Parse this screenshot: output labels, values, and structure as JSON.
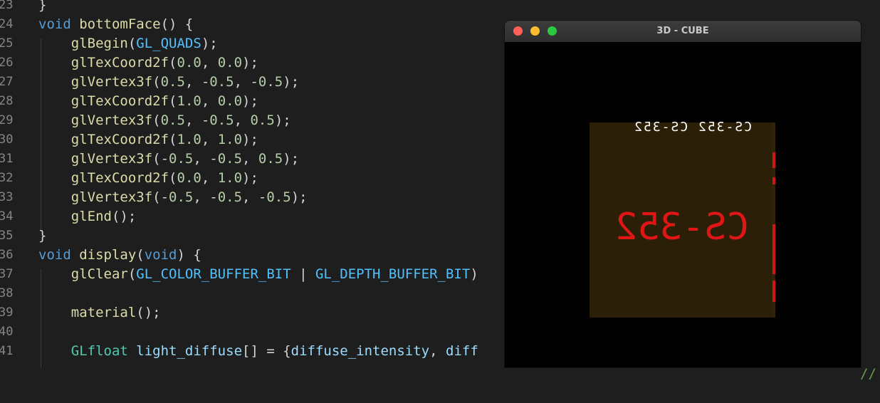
{
  "editor": {
    "lines": [
      {
        "num": "23",
        "tokens": [
          {
            "t": "}",
            "c": "pl"
          }
        ]
      },
      {
        "num": "24",
        "tokens": [
          {
            "t": "void ",
            "c": "kw"
          },
          {
            "t": "bottomFace",
            "c": "fn"
          },
          {
            "t": "() {",
            "c": "pl"
          }
        ]
      },
      {
        "num": "25",
        "tokens": [
          {
            "t": "    ",
            "c": "pl"
          },
          {
            "t": "glBegin",
            "c": "fn"
          },
          {
            "t": "(",
            "c": "pl"
          },
          {
            "t": "GL_QUADS",
            "c": "const"
          },
          {
            "t": ");",
            "c": "pl"
          }
        ]
      },
      {
        "num": "26",
        "tokens": [
          {
            "t": "    ",
            "c": "pl"
          },
          {
            "t": "glTexCoord2f",
            "c": "fn"
          },
          {
            "t": "(",
            "c": "pl"
          },
          {
            "t": "0.0",
            "c": "num"
          },
          {
            "t": ", ",
            "c": "pl"
          },
          {
            "t": "0.0",
            "c": "num"
          },
          {
            "t": ");",
            "c": "pl"
          }
        ]
      },
      {
        "num": "27",
        "tokens": [
          {
            "t": "    ",
            "c": "pl"
          },
          {
            "t": "glVertex3f",
            "c": "fn"
          },
          {
            "t": "(",
            "c": "pl"
          },
          {
            "t": "0.5",
            "c": "num"
          },
          {
            "t": ", -",
            "c": "pl"
          },
          {
            "t": "0.5",
            "c": "num"
          },
          {
            "t": ", -",
            "c": "pl"
          },
          {
            "t": "0.5",
            "c": "num"
          },
          {
            "t": ");",
            "c": "pl"
          }
        ]
      },
      {
        "num": "28",
        "tokens": [
          {
            "t": "    ",
            "c": "pl"
          },
          {
            "t": "glTexCoord2f",
            "c": "fn"
          },
          {
            "t": "(",
            "c": "pl"
          },
          {
            "t": "1.0",
            "c": "num"
          },
          {
            "t": ", ",
            "c": "pl"
          },
          {
            "t": "0.0",
            "c": "num"
          },
          {
            "t": ");",
            "c": "pl"
          }
        ]
      },
      {
        "num": "29",
        "tokens": [
          {
            "t": "    ",
            "c": "pl"
          },
          {
            "t": "glVertex3f",
            "c": "fn"
          },
          {
            "t": "(",
            "c": "pl"
          },
          {
            "t": "0.5",
            "c": "num"
          },
          {
            "t": ", -",
            "c": "pl"
          },
          {
            "t": "0.5",
            "c": "num"
          },
          {
            "t": ", ",
            "c": "pl"
          },
          {
            "t": "0.5",
            "c": "num"
          },
          {
            "t": ");",
            "c": "pl"
          }
        ]
      },
      {
        "num": "30",
        "tokens": [
          {
            "t": "    ",
            "c": "pl"
          },
          {
            "t": "glTexCoord2f",
            "c": "fn"
          },
          {
            "t": "(",
            "c": "pl"
          },
          {
            "t": "1.0",
            "c": "num"
          },
          {
            "t": ", ",
            "c": "pl"
          },
          {
            "t": "1.0",
            "c": "num"
          },
          {
            "t": ");",
            "c": "pl"
          }
        ]
      },
      {
        "num": "31",
        "tokens": [
          {
            "t": "    ",
            "c": "pl"
          },
          {
            "t": "glVertex3f",
            "c": "fn"
          },
          {
            "t": "(-",
            "c": "pl"
          },
          {
            "t": "0.5",
            "c": "num"
          },
          {
            "t": ", -",
            "c": "pl"
          },
          {
            "t": "0.5",
            "c": "num"
          },
          {
            "t": ", ",
            "c": "pl"
          },
          {
            "t": "0.5",
            "c": "num"
          },
          {
            "t": ");",
            "c": "pl"
          }
        ]
      },
      {
        "num": "32",
        "tokens": [
          {
            "t": "    ",
            "c": "pl"
          },
          {
            "t": "glTexCoord2f",
            "c": "fn"
          },
          {
            "t": "(",
            "c": "pl"
          },
          {
            "t": "0.0",
            "c": "num"
          },
          {
            "t": ", ",
            "c": "pl"
          },
          {
            "t": "1.0",
            "c": "num"
          },
          {
            "t": ");",
            "c": "pl"
          }
        ]
      },
      {
        "num": "33",
        "tokens": [
          {
            "t": "    ",
            "c": "pl"
          },
          {
            "t": "glVertex3f",
            "c": "fn"
          },
          {
            "t": "(-",
            "c": "pl"
          },
          {
            "t": "0.5",
            "c": "num"
          },
          {
            "t": ", -",
            "c": "pl"
          },
          {
            "t": "0.5",
            "c": "num"
          },
          {
            "t": ", -",
            "c": "pl"
          },
          {
            "t": "0.5",
            "c": "num"
          },
          {
            "t": ");",
            "c": "pl"
          }
        ]
      },
      {
        "num": "34",
        "tokens": [
          {
            "t": "    ",
            "c": "pl"
          },
          {
            "t": "glEnd",
            "c": "fn"
          },
          {
            "t": "();",
            "c": "pl"
          }
        ]
      },
      {
        "num": "35",
        "tokens": [
          {
            "t": "}",
            "c": "pl"
          }
        ]
      },
      {
        "num": "36",
        "tokens": [
          {
            "t": "void ",
            "c": "kw"
          },
          {
            "t": "display",
            "c": "fn"
          },
          {
            "t": "(",
            "c": "pl"
          },
          {
            "t": "void",
            "c": "kw"
          },
          {
            "t": ") {",
            "c": "pl"
          }
        ]
      },
      {
        "num": "37",
        "tokens": [
          {
            "t": "    ",
            "c": "pl"
          },
          {
            "t": "glClear",
            "c": "fn"
          },
          {
            "t": "(",
            "c": "pl"
          },
          {
            "t": "GL_COLOR_BUFFER_BIT",
            "c": "const"
          },
          {
            "t": " | ",
            "c": "pl"
          },
          {
            "t": "GL_DEPTH_BUFFER_BIT",
            "c": "const"
          },
          {
            "t": ")",
            "c": "pl"
          }
        ]
      },
      {
        "num": "38",
        "tokens": []
      },
      {
        "num": "39",
        "tokens": [
          {
            "t": "    ",
            "c": "pl"
          },
          {
            "t": "material",
            "c": "fn"
          },
          {
            "t": "();",
            "c": "pl"
          }
        ]
      },
      {
        "num": "40",
        "tokens": []
      },
      {
        "num": "41",
        "tokens": [
          {
            "t": "    ",
            "c": "pl"
          },
          {
            "t": "GLfloat",
            "c": "ty"
          },
          {
            "t": " ",
            "c": "pl"
          },
          {
            "t": "light_diffuse",
            "c": "var"
          },
          {
            "t": "[] = {",
            "c": "pl"
          },
          {
            "t": "diffuse_intensity",
            "c": "var"
          },
          {
            "t": ", ",
            "c": "pl"
          },
          {
            "t": "diff",
            "c": "var"
          }
        ]
      }
    ],
    "trailing_comment": "//"
  },
  "window": {
    "title": "3D - CUBE",
    "close_color": "#ff5f57",
    "minimize_color": "#febc2e",
    "zoom_color": "#28c840",
    "cube_label": "CS-352",
    "cube_top_label": "CS-352 CS-352",
    "face_color": "#2b1f07",
    "text_color": "#e01515"
  }
}
